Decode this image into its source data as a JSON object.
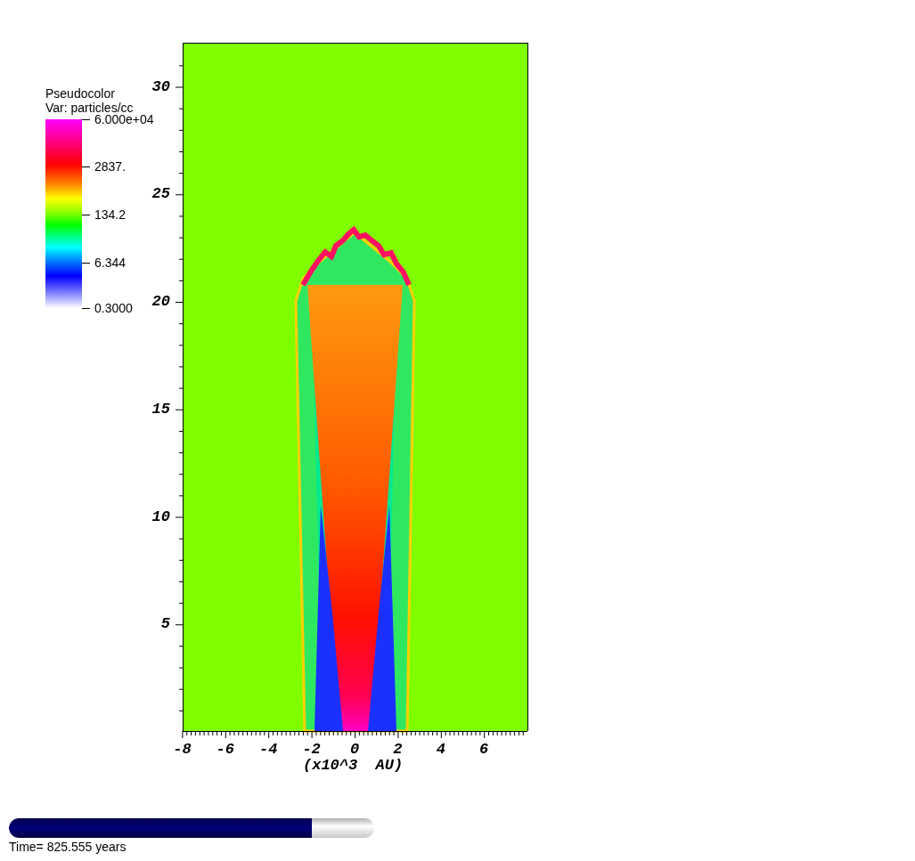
{
  "legend": {
    "title": "Pseudocolor",
    "variable": "Var: particles/cc",
    "labels": [
      "6.000e+04",
      "2837.",
      "134.2",
      "6.344",
      "0.3000"
    ]
  },
  "plot": {
    "y_ticks": [
      "30",
      "25",
      "20",
      "15",
      "10",
      "5"
    ],
    "x_ticks": [
      "-8",
      "-6",
      "-4",
      "-2",
      "0",
      "2",
      "4",
      "6"
    ],
    "x_axis_label": "(x10^3  AU)"
  },
  "time_slider": {
    "level": 0.83,
    "label": "Time= 825.555 years"
  }
}
